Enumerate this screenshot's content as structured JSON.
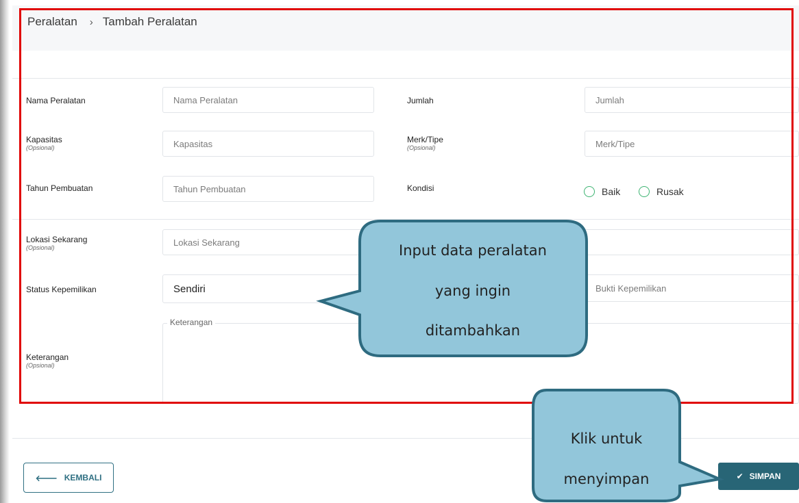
{
  "breadcrumb": {
    "parent": "Peralatan",
    "separator": "›",
    "current": "Tambah Peralatan"
  },
  "form": {
    "optional_tag": "(Opsional)",
    "nama": {
      "label": "Nama Peralatan",
      "placeholder": "Nama Peralatan"
    },
    "jumlah": {
      "label": "Jumlah",
      "placeholder": "Jumlah"
    },
    "kapasitas": {
      "label": "Kapasitas",
      "placeholder": "Kapasitas"
    },
    "merk": {
      "label": "Merk/Tipe",
      "placeholder": "Merk/Tipe"
    },
    "tahun": {
      "label": "Tahun Pembuatan",
      "placeholder": "Tahun Pembuatan"
    },
    "kondisi": {
      "label": "Kondisi",
      "options": [
        "Baik",
        "Rusak"
      ]
    },
    "lokasi": {
      "label": "Lokasi Sekarang",
      "placeholder": "Lokasi Sekarang"
    },
    "status": {
      "label": "Status Kepemilikan",
      "value": "Sendiri"
    },
    "bukti": {
      "placeholder": "Bukti Kepemilikan"
    },
    "keterangan": {
      "label": "Keterangan",
      "legend": "Keterangan"
    }
  },
  "buttons": {
    "back": "KEMBALI",
    "save": "SIMPAN"
  },
  "callouts": {
    "input": [
      "Input data peralatan",
      "yang ingin",
      "ditambahkan"
    ],
    "save": [
      "Klik untuk",
      "menyimpan"
    ]
  },
  "colors": {
    "accent": "#286576",
    "radio": "#3cb371",
    "highlight": "#e00000",
    "callout_fill": "#92c6da",
    "callout_stroke": "#2e6b80"
  }
}
